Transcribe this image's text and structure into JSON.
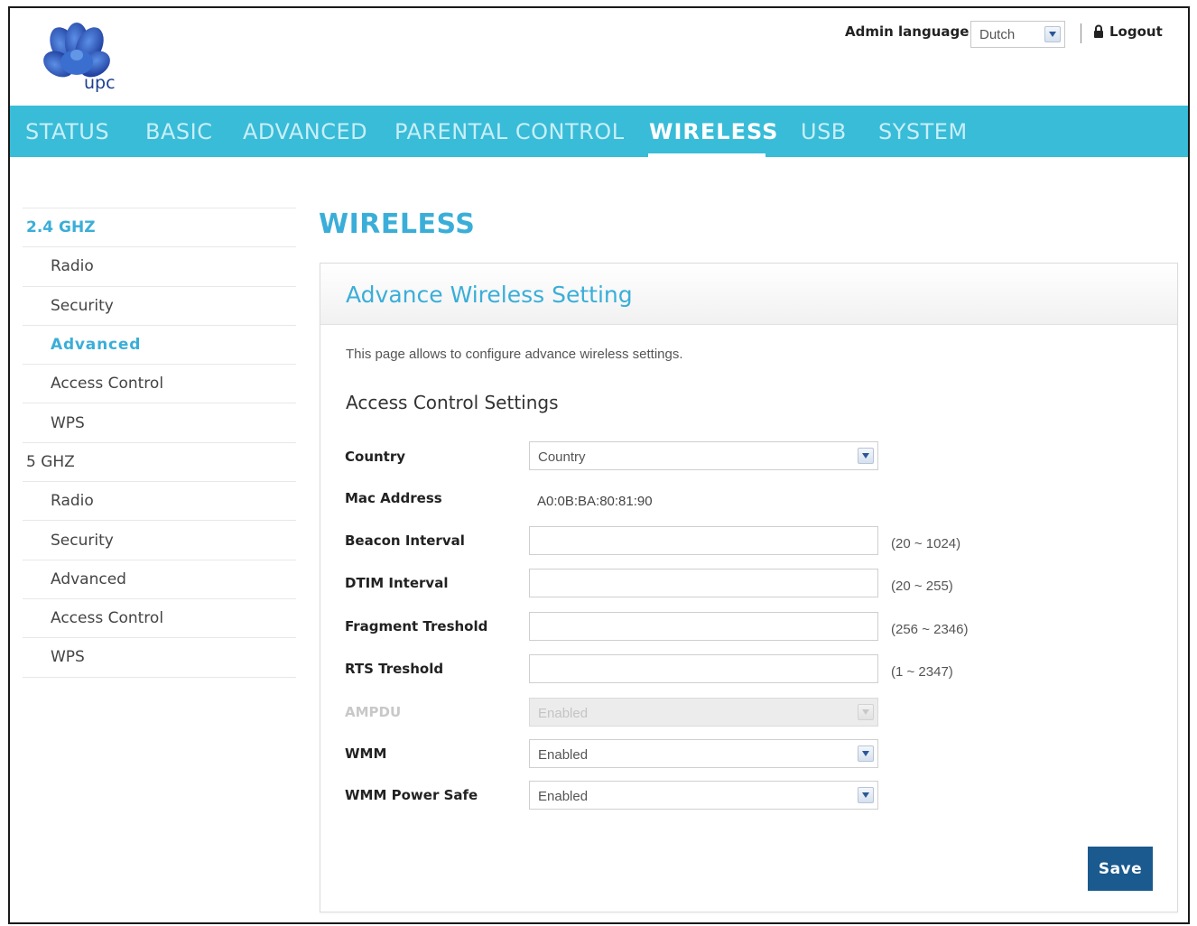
{
  "header": {
    "logo_text": "upc",
    "admin_language_label": "Admin language:",
    "admin_language_value": "Dutch",
    "logout_label": "Logout"
  },
  "nav": {
    "items": [
      {
        "label": "STATUS"
      },
      {
        "label": "BASIC"
      },
      {
        "label": "ADVANCED"
      },
      {
        "label": "PARENTAL CONTROL"
      },
      {
        "label": "WIRELESS"
      },
      {
        "label": "USB"
      },
      {
        "label": "SYSTEM"
      }
    ],
    "active": "WIRELESS"
  },
  "sidebar": {
    "groups": [
      {
        "label": "2.4 GHZ",
        "items": [
          "Radio",
          "Security",
          "Advanced",
          "Access Control",
          "WPS"
        ]
      },
      {
        "label": "5 GHZ",
        "items": [
          "Radio",
          "Security",
          "Advanced",
          "Access Control",
          "WPS"
        ]
      }
    ],
    "active_group": "2.4 GHZ",
    "active_item": "Advanced"
  },
  "main": {
    "page_title": "WIRELESS",
    "panel_title": "Advance Wireless Setting",
    "description": "This page allows to configure advance wireless settings.",
    "section_title": "Access Control Settings",
    "fields": {
      "country": {
        "label": "Country",
        "value": "Country"
      },
      "mac_address": {
        "label": "Mac Address",
        "value": "A0:0B:BA:80:81:90"
      },
      "beacon_interval": {
        "label": "Beacon Interval",
        "value": "",
        "range": "(20 ~ 1024)"
      },
      "dtim_interval": {
        "label": "DTIM Interval",
        "value": "",
        "range": "(20 ~ 255)"
      },
      "fragment_treshold": {
        "label": "Fragment Treshold",
        "value": "",
        "range": "(256 ~ 2346)"
      },
      "rts_treshold": {
        "label": "RTS Treshold",
        "value": "",
        "range": "(1 ~ 2347)"
      },
      "ampdu": {
        "label": "AMPDU",
        "value": "Enabled",
        "disabled": true
      },
      "wmm": {
        "label": "WMM",
        "value": "Enabled"
      },
      "wmm_power_safe": {
        "label": "WMM Power Safe",
        "value": "Enabled"
      }
    },
    "save_label": "Save"
  },
  "colors": {
    "nav_bg": "#38bcd8",
    "accent": "#3aaed8",
    "save_button": "#1b5a8e"
  }
}
